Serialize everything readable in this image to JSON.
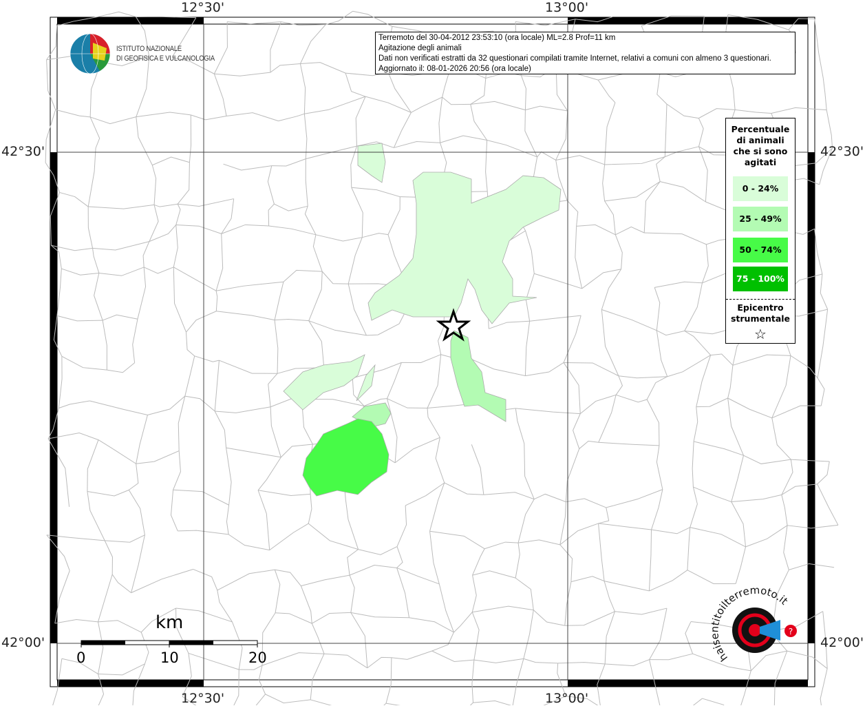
{
  "map": {
    "coords": {
      "lon_left": "12°30'",
      "lon_right": "13°00'",
      "lat_top": "42°30'",
      "lat_bottom": "42°00'"
    },
    "info_lines": [
      "Terremoto del 30-04-2012 23:53:10 (ora locale) ML=2.8 Prof=11 km",
      "Agitazione degli animali",
      "Dati non verificati estratti da 32 questionari compilati tramite Internet, relativi a comuni con almeno 3 questionari.",
      "Aggiornato il: 08-01-2026 20:56 (ora locale)"
    ],
    "legend": {
      "title": "Percentuale di animali che si sono agitati",
      "classes": [
        {
          "label": "0 - 24%",
          "color": "#d9fdd9"
        },
        {
          "label": "25 - 49%",
          "color": "#b3fbb3"
        },
        {
          "label": "50 - 74%",
          "color": "#47fb47"
        },
        {
          "label": "75 - 100%",
          "color": "#00c000"
        }
      ],
      "epicenter_label": "Epicentro strumentale",
      "epicenter_symbol": "☆"
    },
    "scale": {
      "unit": "km",
      "labels": [
        "0",
        "10",
        "20"
      ]
    },
    "logo_ingv": {
      "line1": "ISTITUTO NAZIONALE",
      "line2": "DI GEOFISICA E VULCANOLOGIA"
    },
    "logo_hsit": "www.haisentitoilterremoto.it"
  }
}
